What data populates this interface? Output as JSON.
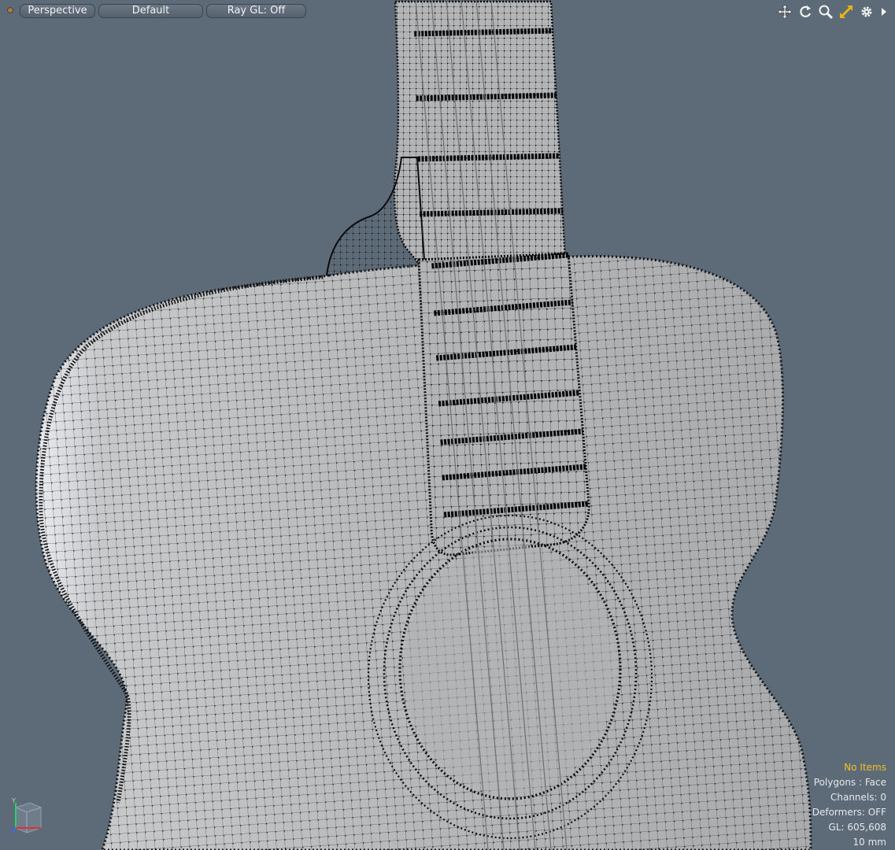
{
  "toolbar": {
    "view_mode": "Perspective",
    "shading": "Default",
    "raygl": "Ray GL: Off"
  },
  "nav_icons": [
    "move-view-icon",
    "rotate-view-icon",
    "zoom-view-icon",
    "fit-view-icon",
    "settings-gear-icon",
    "expand-arrow-icon"
  ],
  "hud": {
    "selection": "No Items",
    "polygons": "Polygons : Face",
    "channels": "Channels: 0",
    "deformers": "Deformers: OFF",
    "gl_count": "GL: 605,608",
    "grid_size": "10 mm"
  },
  "colors": {
    "viewport_bg": "#5d6b79",
    "mesh_surface": "#b6b8ba",
    "mesh_wire": "#111111",
    "hud_accent": "#f2c020",
    "hud_text": "#e6e8ea"
  }
}
